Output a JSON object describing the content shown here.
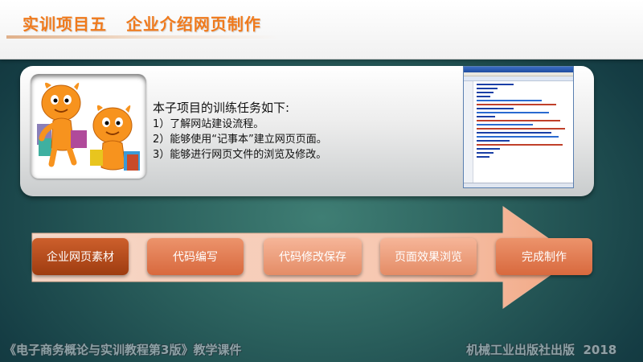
{
  "header": {
    "title": "实训项目五   企业介绍网页制作"
  },
  "intro": {
    "heading": "本子项目的训练任务如下:",
    "tasks": [
      "1）了解网站建设流程。",
      "2）能够使用“记事本”建立网页页面。",
      "3）能够进行网页文件的浏览及修改。"
    ]
  },
  "flow": {
    "steps": [
      "企业网页素材",
      "代码编写",
      "代码修改保存",
      "页面效果浏览",
      "完成制作"
    ]
  },
  "footer": {
    "left": "《电子商务概论与实训教程第3版》教学课件",
    "right": "机械工业出版社出版  2018"
  },
  "colors": {
    "title_orange": "#f07a1c",
    "step_active": "#b84c1c",
    "step_light": "#e48c66",
    "bg_teal": "#2a5f5c"
  },
  "icons": [
    "mascot-illustration",
    "editor-screenshot",
    "process-arrow"
  ]
}
